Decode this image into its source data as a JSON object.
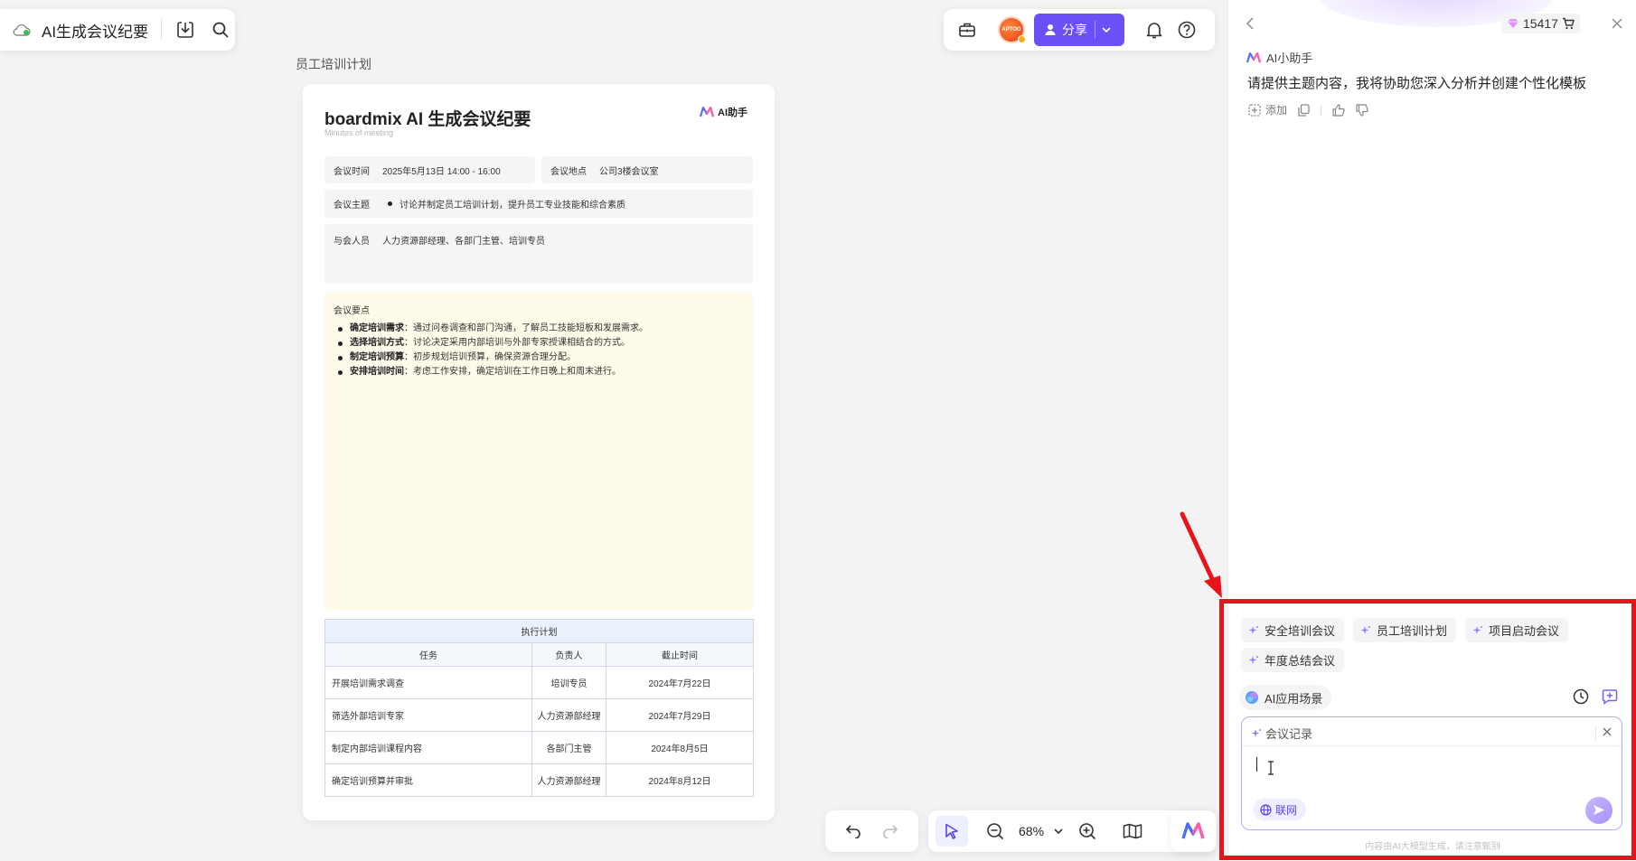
{
  "app": {
    "title": "AI生成会议纪要"
  },
  "frame_label": "员工培训计划",
  "document": {
    "title": "boardmix AI 生成会议纪要",
    "subtitle": "Minutes of meeting",
    "logo_text": "AI助手",
    "time_label": "会议时间",
    "time_value": "2025年5月13日 14:00 - 16:00",
    "place_label": "会议地点",
    "place_value": "公司3楼会议室",
    "topic_label": "会议主题",
    "topic_value": "讨论并制定员工培训计划，提升员工专业技能和综合素质",
    "people_label": "与会人员",
    "people_value": "人力资源部经理、各部门主管、培训专员",
    "points_title": "会议要点",
    "points": [
      {
        "bold": "确定培训需求",
        "text": "：通过问卷调查和部门沟通，了解员工技能短板和发展需求。"
      },
      {
        "bold": "选择培训方式",
        "text": "：讨论决定采用内部培训与外部专家授课相结合的方式。"
      },
      {
        "bold": "制定培训预算",
        "text": "：初步规划培训预算，确保资源合理分配。"
      },
      {
        "bold": "安排培训时间",
        "text": "：考虑工作安排，确定培训在工作日晚上和周末进行。"
      }
    ],
    "plan": {
      "caption": "执行计划",
      "headers": [
        "任务",
        "负责人",
        "截止时间"
      ],
      "rows": [
        [
          "开展培训需求调查",
          "培训专员",
          "2024年7月22日"
        ],
        [
          "筛选外部培训专家",
          "人力资源部经理",
          "2024年7月29日"
        ],
        [
          "制定内部培训课程内容",
          "各部门主管",
          "2024年8月5日"
        ],
        [
          "确定培训预算并审批",
          "人力资源部经理",
          "2024年8月12日"
        ]
      ]
    }
  },
  "toolbar": {
    "avatar_text": "APTOO",
    "share_label": "分享",
    "zoom_value": "68%"
  },
  "panel": {
    "credits": "15417",
    "assistant_name": "AI小助手",
    "assistant_message": "请提供主题内容，我将协助您深入分析并创建个性化模板",
    "add_label": "添加",
    "suggestions": [
      "安全培训会议",
      "员工培训计划",
      "项目启动会议",
      "年度总结会议"
    ],
    "scene_label": "AI应用场景",
    "input_tag": "会议记录",
    "input_value": "",
    "web_label": "联网",
    "disclaimer": "内容由AI大模型生成，请注意甄别"
  },
  "colors": {
    "accent": "#6c4ff6",
    "highlight_box": "#e8141c",
    "points_bg": "#fffbeb",
    "table_border": "#cfd6e2"
  }
}
